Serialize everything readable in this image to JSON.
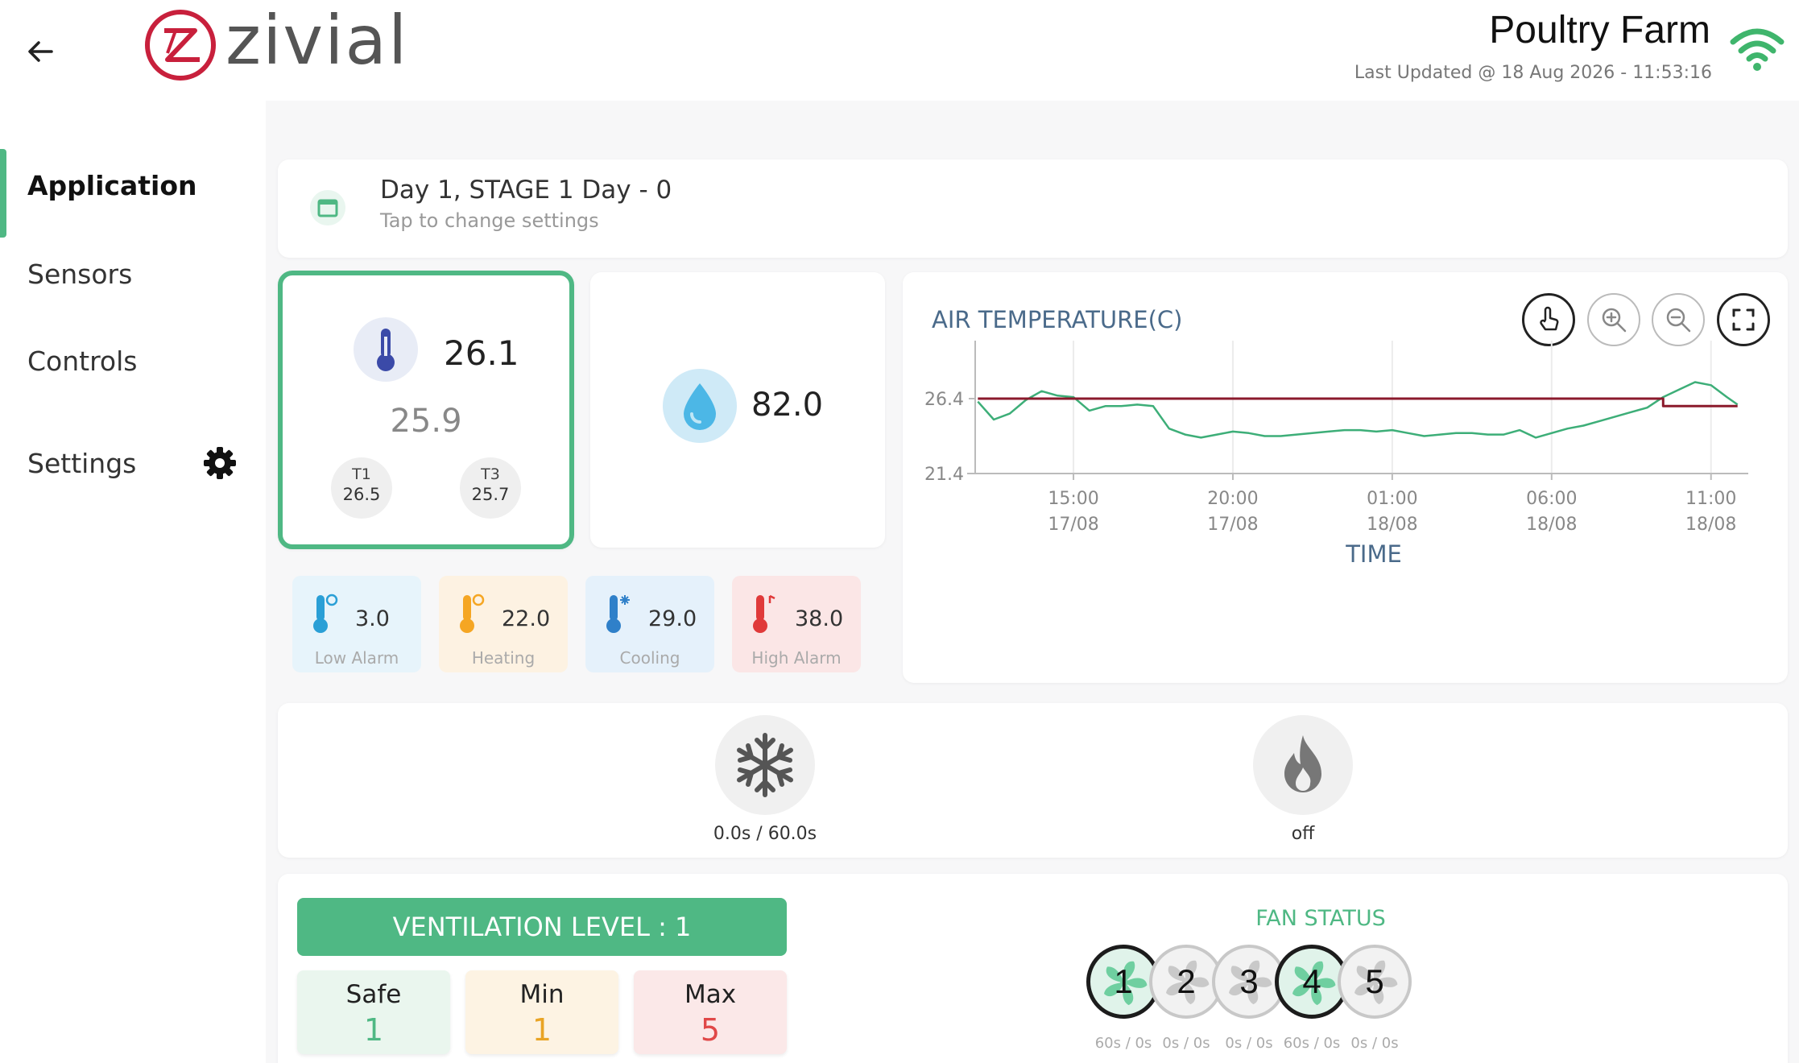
{
  "header": {
    "brand": "ZIVIAL",
    "farm_name": "Poultry Farm",
    "last_updated": "Last Updated @ 18 Aug 2026 - 11:53:16"
  },
  "sidebar": {
    "items": [
      {
        "label": "Application"
      },
      {
        "label": "Sensors"
      },
      {
        "label": "Controls"
      },
      {
        "label": "Settings"
      }
    ]
  },
  "stage": {
    "title": "Day 1, STAGE 1 Day - 0",
    "subtitle": "Tap to change settings"
  },
  "temperature": {
    "current": "26.1",
    "average": "25.9",
    "sensors": [
      {
        "label": "T1",
        "value": "26.5"
      },
      {
        "label": "T3",
        "value": "25.7"
      }
    ]
  },
  "humidity": {
    "value": "82.0"
  },
  "alarms": [
    {
      "value": "3.0",
      "label": "Low Alarm",
      "bg": "#e7f4fb",
      "color": "#2a9fd6"
    },
    {
      "value": "22.0",
      "label": "Heating",
      "bg": "#fdf2e2",
      "color": "#f5a623"
    },
    {
      "value": "29.0",
      "label": "Cooling",
      "bg": "#e5f1fb",
      "color": "#2f80c9"
    },
    {
      "value": "38.0",
      "label": "High Alarm",
      "bg": "#fbe6e6",
      "color": "#e03a3a"
    }
  ],
  "chart_data": {
    "type": "line",
    "title": "AIR TEMPERATURE(C)",
    "xlabel": "TIME",
    "ylabel": "",
    "x_ticks": [
      {
        "time": "15:00",
        "date": "17/08"
      },
      {
        "time": "20:00",
        "date": "17/08"
      },
      {
        "time": "01:00",
        "date": "18/08"
      },
      {
        "time": "06:00",
        "date": "18/08"
      },
      {
        "time": "11:00",
        "date": "18/08"
      }
    ],
    "y_ticks": [
      "26.4",
      "21.4"
    ],
    "ylim": [
      21.4,
      28.5
    ],
    "xlim": [
      "17/08 11:55",
      "18/08 11:55"
    ],
    "series": [
      {
        "color": "#3dae78",
        "x": [
          "17/08 12:00",
          "17/08 12:30",
          "17/08 13:00",
          "17/08 13:30",
          "17/08 14:00",
          "17/08 14:30",
          "17/08 15:00",
          "17/08 15:30",
          "17/08 16:00",
          "17/08 16:30",
          "17/08 17:00",
          "17/08 17:30",
          "17/08 18:00",
          "17/08 18:30",
          "17/08 19:00",
          "17/08 19:30",
          "17/08 20:00",
          "17/08 20:30",
          "17/08 21:00",
          "17/08 21:30",
          "17/08 22:00",
          "17/08 22:30",
          "17/08 23:00",
          "17/08 23:30",
          "18/08 00:00",
          "18/08 00:30",
          "18/08 01:00",
          "18/08 01:30",
          "18/08 02:00",
          "18/08 02:30",
          "18/08 03:00",
          "18/08 03:30",
          "18/08 04:00",
          "18/08 04:30",
          "18/08 05:00",
          "18/08 05:30",
          "18/08 06:00",
          "18/08 06:30",
          "18/08 07:00",
          "18/08 07:30",
          "18/08 08:00",
          "18/08 08:30",
          "18/08 09:00",
          "18/08 09:30",
          "18/08 10:00",
          "18/08 10:30",
          "18/08 11:00",
          "18/08 11:30",
          "18/08 11:50"
        ],
        "values": [
          26.2,
          25.0,
          25.4,
          26.3,
          26.9,
          26.6,
          26.5,
          25.6,
          25.9,
          25.9,
          26.0,
          25.9,
          24.4,
          24.0,
          23.8,
          24.0,
          24.2,
          24.1,
          23.9,
          23.9,
          24.0,
          24.1,
          24.2,
          24.3,
          24.3,
          24.2,
          24.3,
          24.1,
          23.9,
          24.0,
          24.1,
          24.1,
          24.0,
          24.0,
          24.3,
          23.8,
          24.1,
          24.4,
          24.6,
          24.9,
          25.2,
          25.5,
          25.8,
          26.5,
          27.0,
          27.5,
          27.3,
          26.5,
          26.0
        ]
      },
      {
        "color": "#8b1a2c",
        "x": [
          "17/08 12:00",
          "18/08 09:30",
          "18/08 09:30",
          "18/08 11:50"
        ],
        "values": [
          26.4,
          26.4,
          25.9,
          25.9
        ]
      }
    ]
  },
  "devices": [
    {
      "name": "cooling",
      "icon": "snowflake-icon",
      "label": "0.0s / 60.0s"
    },
    {
      "name": "heating",
      "icon": "flame-icon",
      "label": "off"
    }
  ],
  "ventilation": {
    "title": "VENTILATION LEVEL : 1",
    "levels": [
      {
        "label": "Safe",
        "value": "1",
        "bg": "#eaf6ee",
        "color": "#4fb884"
      },
      {
        "label": "Min",
        "value": "1",
        "bg": "#fdf3e3",
        "color": "#e9a425"
      },
      {
        "label": "Max",
        "value": "5",
        "bg": "#fbe8e8",
        "color": "#e04848"
      }
    ]
  },
  "fans": {
    "title": "FAN STATUS",
    "items": [
      {
        "num": "1",
        "on": true,
        "label": "60s / 0s"
      },
      {
        "num": "2",
        "on": false,
        "label": "0s / 0s"
      },
      {
        "num": "3",
        "on": false,
        "label": "0s / 0s"
      },
      {
        "num": "4",
        "on": true,
        "label": "60s / 0s"
      },
      {
        "num": "5",
        "on": false,
        "label": "0s / 0s"
      }
    ]
  }
}
